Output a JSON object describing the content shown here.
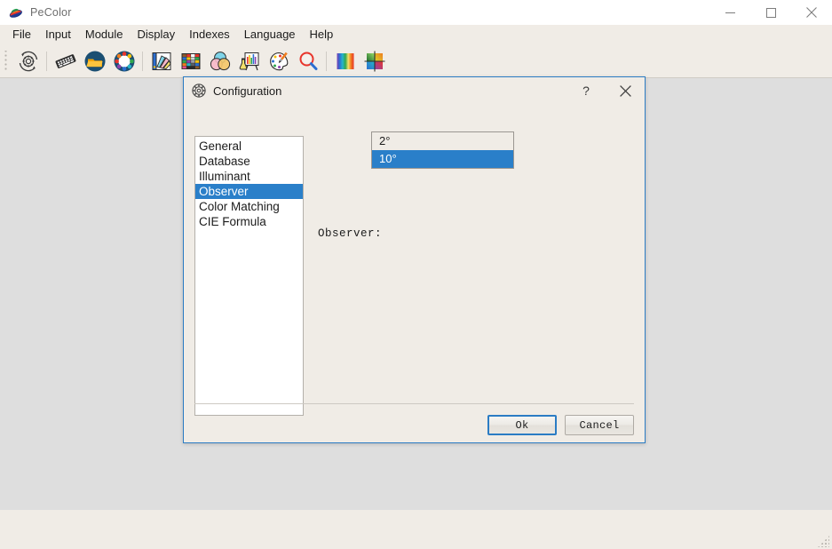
{
  "window": {
    "title": "PeColor",
    "icon": "pecolor-app-icon",
    "controls": {
      "minimize": "minimize-icon",
      "maximize": "maximize-icon",
      "close": "close-icon"
    }
  },
  "menu": {
    "items": [
      {
        "label": "File"
      },
      {
        "label": "Input"
      },
      {
        "label": "Module"
      },
      {
        "label": "Display"
      },
      {
        "label": "Indexes"
      },
      {
        "label": "Language"
      },
      {
        "label": "Help"
      }
    ]
  },
  "toolbar": {
    "buttons": [
      {
        "name": "settings-refresh-icon",
        "tip": "Settings"
      },
      {
        "name": "keyboard-icon",
        "tip": "Keyboard Input"
      },
      {
        "name": "open-folder-icon",
        "tip": "Open"
      },
      {
        "name": "color-wheel-icon",
        "tip": "Color Wheel"
      },
      {
        "name": "color-fan-icon",
        "tip": "Color Fan"
      },
      {
        "name": "color-chart-icon",
        "tip": "Color Chart"
      },
      {
        "name": "venn-colors-icon",
        "tip": "Color Mixing"
      },
      {
        "name": "lab-easel-icon",
        "tip": "Laboratory"
      },
      {
        "name": "palette-brush-icon",
        "tip": "Palette"
      },
      {
        "name": "magnifier-icon",
        "tip": "Zoom"
      },
      {
        "name": "spectrum-bars-icon",
        "tip": "Spectrum"
      },
      {
        "name": "color-grid-icon",
        "tip": "Color Grid"
      }
    ]
  },
  "dialog": {
    "title": "Configuration",
    "icon": "gear-dialog-icon",
    "help_label": "?",
    "close_label": "✕",
    "categories": [
      {
        "label": "General",
        "selected": false
      },
      {
        "label": "Database",
        "selected": false
      },
      {
        "label": "Illuminant",
        "selected": false
      },
      {
        "label": "Observer",
        "selected": true
      },
      {
        "label": "Color Matching",
        "selected": false
      },
      {
        "label": "CIE Formula",
        "selected": false
      }
    ],
    "observer": {
      "label": "Observer:",
      "options": [
        {
          "label": "2°",
          "selected": false
        },
        {
          "label": "10°",
          "selected": true
        }
      ],
      "value": "10°"
    },
    "buttons": {
      "ok": "Ok",
      "cancel": "Cancel"
    }
  },
  "colors": {
    "accent_blue": "#2a7fc9",
    "dialog_border": "#2b7cc4",
    "window_chrome": "#f0ece6",
    "client_bg": "#dedede"
  }
}
